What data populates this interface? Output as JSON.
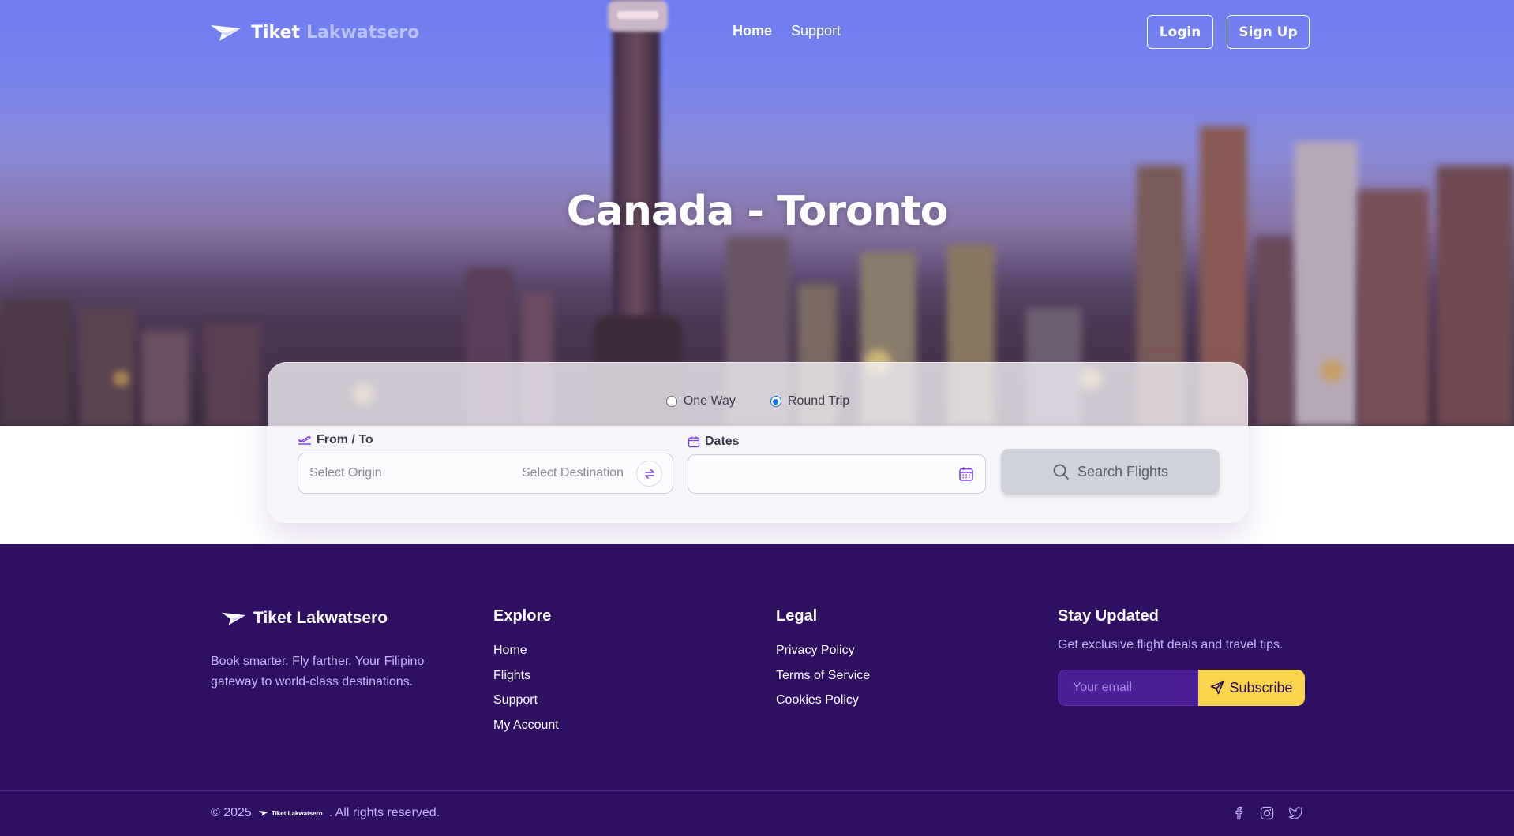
{
  "nav": {
    "brand_first": "Tiket",
    "brand_second": "Lakwatsero",
    "links": [
      {
        "label": "Home",
        "active": true
      },
      {
        "label": "Support",
        "active": false
      }
    ],
    "login_label": "Login",
    "signup_label": "Sign Up"
  },
  "hero": {
    "title": "Canada - Toronto"
  },
  "search": {
    "trip_types": [
      {
        "label": "One Way",
        "selected": false
      },
      {
        "label": "Round Trip",
        "selected": true
      }
    ],
    "from_to_label": "From / To",
    "origin_placeholder": "Select Origin",
    "destination_placeholder": "Select Destination",
    "dates_label": "Dates",
    "dates_value": "",
    "search_button_label": "Search Flights"
  },
  "footer": {
    "brand": "Tiket Lakwatsero",
    "tagline": "Book smarter. Fly farther. Your Filipino gateway to world-class destinations.",
    "explore": {
      "heading": "Explore",
      "links": [
        "Home",
        "Flights",
        "Support",
        "My Account"
      ]
    },
    "legal": {
      "heading": "Legal",
      "links": [
        "Privacy Policy",
        "Terms of Service",
        "Cookies Policy"
      ]
    },
    "stay_updated": {
      "heading": "Stay Updated",
      "text": "Get exclusive flight deals and travel tips.",
      "email_placeholder": "Your email",
      "subscribe_label": "Subscribe"
    },
    "copyright_prefix": "© 2025",
    "copyright_brand": "Tiket Lakwatsero",
    "copyright_suffix": ". All rights reserved.",
    "socials": [
      "facebook-icon",
      "instagram-icon",
      "twitter-icon"
    ]
  },
  "colors": {
    "accent_purple": "#7c3aed",
    "footer_bg": "#2e0f62",
    "subscribe_yellow": "#fcd34d",
    "radio_blue": "#1a73e8"
  }
}
